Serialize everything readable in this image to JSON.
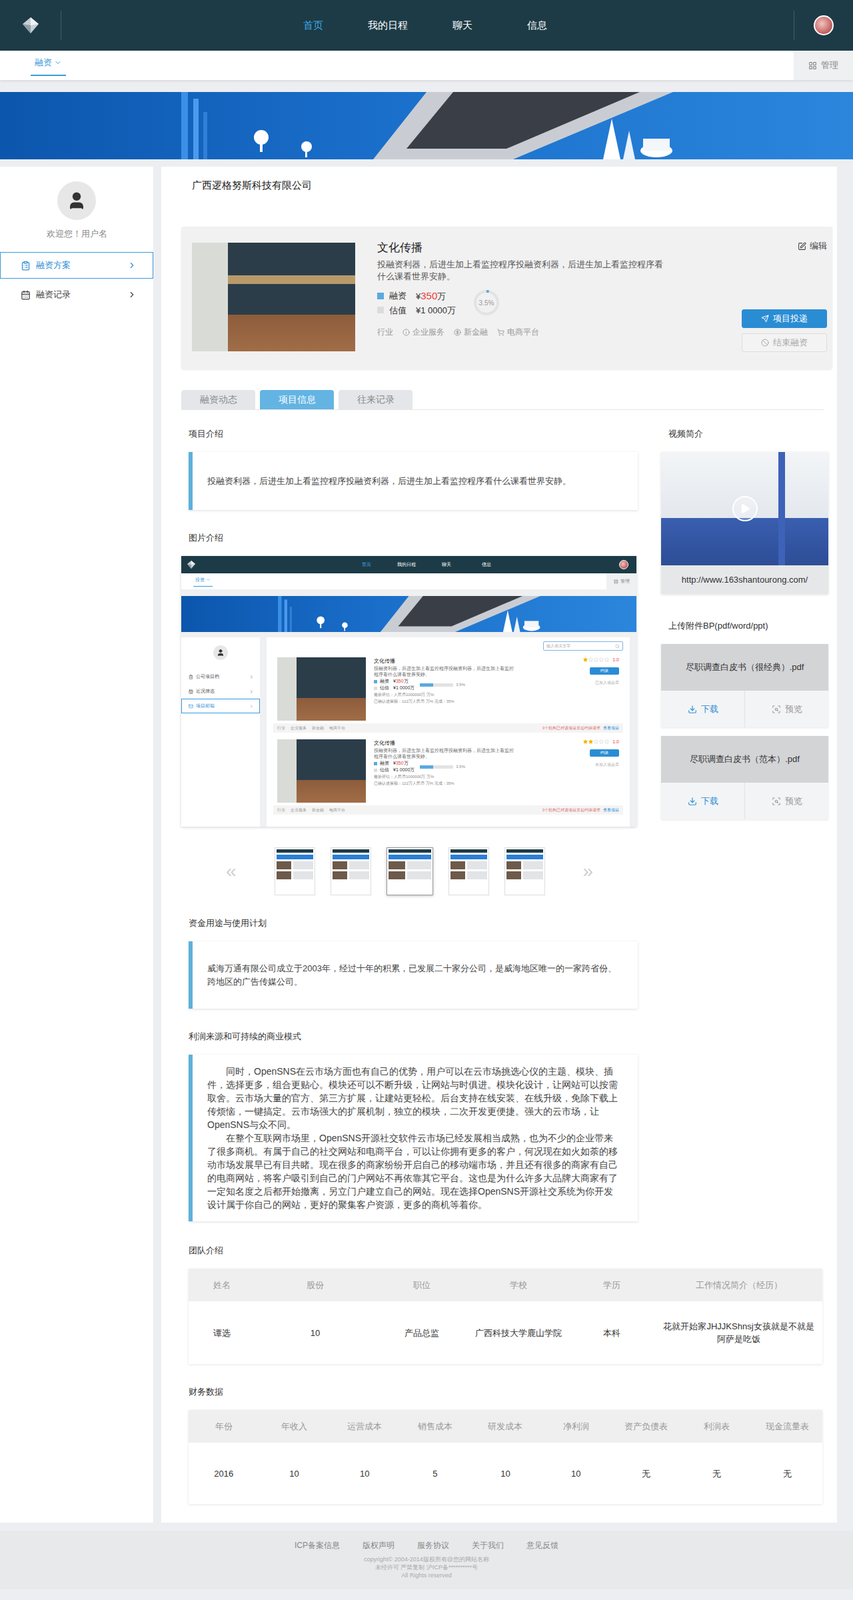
{
  "nav": {
    "items": [
      {
        "label": "首页",
        "selected": true
      },
      {
        "label": "我的日程",
        "selected": false
      },
      {
        "label": "聊天",
        "selected": false
      },
      {
        "label": "信息",
        "selected": false
      }
    ]
  },
  "subnav": {
    "tab": "融资",
    "manage": "管理"
  },
  "sidebar": {
    "greeting": "欢迎您！用户名",
    "items": [
      {
        "label": "融资方案",
        "selected": true
      },
      {
        "label": "融资记录",
        "selected": false
      }
    ]
  },
  "company": "广西逻格努斯科技有限公司",
  "project": {
    "title": "文化传播",
    "description": "投融资利器，后进生加上看监控程序投融资利器，后进生加上看监控程序看什么课看世界安静。",
    "money": [
      {
        "label": "融资",
        "currency": "¥",
        "amount": "350",
        "unit": "万",
        "highlight": true,
        "color": "#5aa9e0"
      },
      {
        "label": "估值",
        "currency": "¥",
        "amount": "1 0000",
        "unit": "万",
        "highlight": false,
        "color": "#dcdcdc"
      }
    ],
    "progress": {
      "reading": "3.5%",
      "level": 0.035
    },
    "industry": {
      "label": "行业",
      "tags": [
        "企业服务",
        "新金融",
        "电商平台"
      ]
    },
    "edit": "编辑",
    "actions": [
      {
        "label": "项目投递",
        "kind": "primary",
        "disabled": false
      },
      {
        "label": "结束融资",
        "kind": "secondary",
        "disabled": true
      }
    ]
  },
  "tabs": [
    {
      "label": "融资动态",
      "selected": false
    },
    {
      "label": "项目信息",
      "selected": true
    },
    {
      "label": "往来记录",
      "selected": false
    }
  ],
  "intro": {
    "title": "项目介绍",
    "text": "投融资利器，后进生加上看监控程序投融资利器，后进生加上看监控程序看什么课看世界安静。"
  },
  "gallery": {
    "title": "图片介绍",
    "prev": "«",
    "next": "»",
    "thumbnails": [
      {
        "selected": false
      },
      {
        "selected": false
      },
      {
        "selected": true
      },
      {
        "selected": false
      },
      {
        "selected": false
      }
    ],
    "preview": {
      "nav": [
        {
          "label": "首页",
          "selected": true
        },
        {
          "label": "我的日程",
          "selected": false
        },
        {
          "label": "聊天",
          "selected": false
        },
        {
          "label": "信息",
          "selected": false
        }
      ],
      "tab": "投资",
      "manage": "管理",
      "sidebar": [
        {
          "label": "公司项目档",
          "selected": false
        },
        {
          "label": "近况筛选",
          "selected": false
        },
        {
          "label": "项目邮箱",
          "selected": true
        }
      ],
      "search": "输入相关文字",
      "cards": [
        {
          "title": "文化传播",
          "description": "投融资利器，后进生加上看监控程序投融资利器，后进生加上看监控程序看什么课看世界安静。",
          "money": [
            {
              "label": "融资",
              "currency": "¥",
              "amount": "350",
              "unit": "万",
              "highlight": true,
              "color": "#5aa9e0"
            },
            {
              "label": "估值",
              "currency": "¥",
              "amount": "1 0000",
              "unit": "万",
              "highlight": false,
              "color": "#dcdcdc"
            }
          ],
          "progress": {
            "reading": "3.5%",
            "level": 0.4
          },
          "stats": [
            "最新评估：人民币1000000万 万%",
            "已确认进展额：122万人民币 万% 完成：35%"
          ],
          "stars": 1,
          "rating": "1.0",
          "action": "约谈",
          "note": "已加入项目库",
          "tags": [
            "行业",
            "企业服务",
            "新金融",
            "电商平台"
          ],
          "footnote": "3个机构已对该项目发起约谈请求",
          "link": "查看项目"
        },
        {
          "title": "文化传播",
          "description": "投融资利器，后进生加上看监控程序投融资利器，后进生加上看监控程序看什么课看世界安静。",
          "money": [
            {
              "label": "融资",
              "currency": "¥",
              "amount": "350",
              "unit": "万",
              "highlight": true,
              "color": "#5aa9e0"
            },
            {
              "label": "估值",
              "currency": "¥",
              "amount": "1 0000",
              "unit": "万",
              "highlight": false,
              "color": "#dcdcdc"
            }
          ],
          "progress": {
            "reading": "3.5%",
            "level": 0.4
          },
          "stats": [
            "最新评估：人民币1000000万 万%",
            "已确认进展额：122万人民币 万% 完成：35%"
          ],
          "stars": 2,
          "rating": "1.0",
          "action": "约谈",
          "note": "未加入项目库",
          "tags": [
            "行业",
            "企业服务",
            "新金融",
            "电商平台"
          ],
          "footnote": "3个机构已对该项目发起约谈请求",
          "link": "查看项目"
        }
      ]
    }
  },
  "funds": {
    "title": "资金用途与使用计划",
    "text": "威海万通有限公司成立于2003年，经过十年的积累，已发展二十家分公司，是威海地区唯一的一家跨省份、跨地区的广告传媒公司。"
  },
  "profit": {
    "title": "利润来源和可持续的商业模式",
    "paragraphs": [
      "同时，OpenSNS在云市场方面也有自己的优势，用户可以在云市场挑选心仪的主题、模块、插件，选择更多，组合更贴心。模块还可以不断升级，让网站与时俱进。模块化设计，让网站可以按需取舍。云市场大量的官方、第三方扩展，让建站更轻松。后台支持在线安装、在线升级，免除下载上传烦恼，一键搞定。云市场强大的扩展机制，独立的模块，二次开发更便捷。强大的云市场，让OpenSNS与众不同。",
      "在整个互联网市场里，OpenSNS开源社交软件云市场已经发展相当成熟，也为不少的企业带来了很多商机。有属于自己的社交网站和电商平台，可以让你拥有更多的客户，何况现在如火如荼的移动市场发展早已有目共睹。现在很多的商家纷纷开启自己的移动端市场，并且还有很多的商家有自己的电商网站，将客户吸引到自己的门户网站不再依靠其它平台。这也是为什么许多大品牌大商家有了一定知名度之后都开始撤离，另立门户建立自己的网站。现在选择OpenSNS开源社交系统为你开发设计属于你自己的网站，更好的聚集客户资源，更多的商机等着你。"
    ]
  },
  "video": {
    "title": "视频简介",
    "url": "http://www.163shantourong.com/"
  },
  "attachments": {
    "title": "上传附件BP(pdf/word/ppt)",
    "files": [
      {
        "name": "尽职调查白皮书（很经典）.pdf",
        "download": "下载",
        "preview": "预览"
      },
      {
        "name": "尽职调查白皮书（范本）.pdf",
        "download": "下载",
        "preview": "预览"
      }
    ]
  },
  "team": {
    "title": "团队介绍",
    "columns": [
      "姓名",
      "股份",
      "职位",
      "学校",
      "学历",
      "工作情况简介（经历）"
    ],
    "rows": [
      [
        "谭选",
        "10",
        "产品总监",
        "广西科技大学鹿山学院",
        "本科",
        "花就开始家JHJJKShnsj女孩就是不就是阿萨是吃饭"
      ]
    ]
  },
  "finance": {
    "title": "财务数据",
    "columns": [
      "年份",
      "年收入",
      "运营成本",
      "销售成本",
      "研发成本",
      "净利润",
      "资产负债表",
      "利润表",
      "现金流量表"
    ],
    "rows": [
      [
        "2016",
        "10",
        "10",
        "5",
        "10",
        "10",
        "无",
        "无",
        "无"
      ]
    ]
  },
  "footer": {
    "links": [
      "ICP备案信息",
      "版权声明",
      "服务协议",
      "关于我们",
      "意见反馈"
    ],
    "notes": [
      "copyright© 2004-2014版权所有@您的网站名称",
      "未经许可 严禁复制 沪ICP备**********号",
      "All Rights reserved"
    ]
  }
}
